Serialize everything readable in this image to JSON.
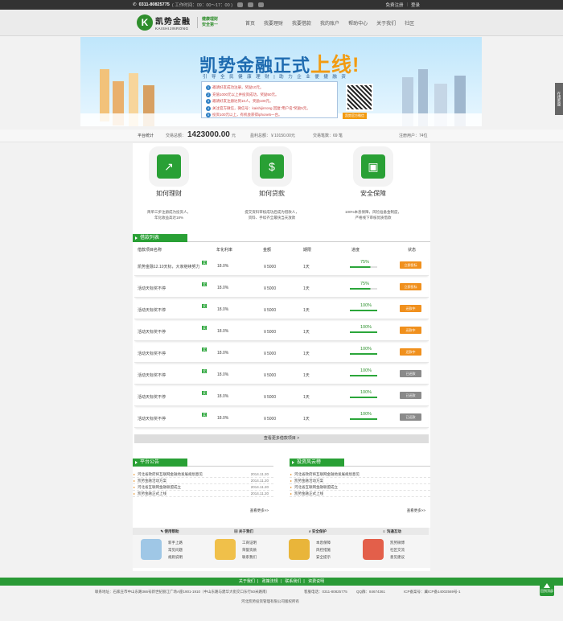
{
  "topbar": {
    "phone": "0311-80825775",
    "hours": "( 工作时间：09：00～17：00 )",
    "register": "免费注册",
    "login": "登录",
    "sep": "|"
  },
  "brand": {
    "mark": "K",
    "name": "凯势金融",
    "en": "KAISHIJINRONG",
    "slogan1": "健康理财",
    "slogan2": "安全第一"
  },
  "nav": [
    "首页",
    "我要理财",
    "我要借款",
    "我的账户",
    "帮助中心",
    "关于我们",
    "社区"
  ],
  "banner": {
    "title": "凯势金融正式",
    "title_highlight": "上线!",
    "subtitle": "引 导 全 民 健 康 理 财   |   助 力 企 业 便 捷 融 资",
    "steps": [
      "邀请好友成功注册，奖励10元。",
      "充值1000元以上并投资成功，奖励50元。",
      "邀请好友注册达到10人，奖励100元。",
      "关注官方微信，微信号：kaishijinrong 回复“用户名”奖励5元。",
      "投资100元以上，有机会获得iphone5一台。"
    ],
    "qr_caption": "凯势官方微信"
  },
  "side_tab": "在线客服",
  "stats": {
    "label": "平台统计",
    "volume_label": "交易总额：",
    "volume": "1423000.00",
    "volume_unit": "元",
    "income_label": "盈利总额：￥10150.00元",
    "count_label": "交易笔数：69 笔",
    "users_label": "注册用户：74位"
  },
  "features": [
    {
      "icon": "trend-up-icon",
      "glyph": "↗",
      "title": "如何理财",
      "desc1": "简单三步注册成为投资人，",
      "desc2": "年化收益高达18%"
    },
    {
      "icon": "money-bag-icon",
      "glyph": "$",
      "title": "如何贷款",
      "desc1": "提交资料审核成功后成为借款人，",
      "desc2": "资料、手续齐全最快当天放款"
    },
    {
      "icon": "lock-icon",
      "glyph": "▣",
      "title": "安全保障",
      "desc1": "100%本息保障，风险准备金制度，",
      "desc2": "严格线下审核优质借款"
    }
  ],
  "loans": {
    "section_title": "借款列表",
    "headers": [
      "借款项目名称",
      "年化利率",
      "金额",
      "期限",
      "进度",
      "状态"
    ],
    "rows": [
      {
        "name": "凯势金融12.10天标，大家继续努力",
        "rate": "18.0%",
        "amount": "￥5000",
        "term": "1天",
        "progress": "75%",
        "progress_value": 75,
        "status": "立即投标",
        "color": "#f0901d"
      },
      {
        "name": "活动天标奖不停",
        "rate": "18.0%",
        "amount": "￥5000",
        "term": "1天",
        "progress": "75%",
        "progress_value": 75,
        "status": "立即投标",
        "color": "#f0901d"
      },
      {
        "name": "活动天标奖不停",
        "rate": "18.0%",
        "amount": "￥5000",
        "term": "1天",
        "progress": "100%",
        "progress_value": 100,
        "status": "还款中",
        "color": "#f0901d"
      },
      {
        "name": "活动天标奖不停",
        "rate": "18.0%",
        "amount": "￥5000",
        "term": "1天",
        "progress": "100%",
        "progress_value": 100,
        "status": "还款中",
        "color": "#f0901d"
      },
      {
        "name": "活动天标奖不停",
        "rate": "18.0%",
        "amount": "￥5000",
        "term": "1天",
        "progress": "100%",
        "progress_value": 100,
        "status": "还款中",
        "color": "#f0901d"
      },
      {
        "name": "活动天标奖不停",
        "rate": "18.0%",
        "amount": "￥5000",
        "term": "1天",
        "progress": "100%",
        "progress_value": 100,
        "status": "已还款",
        "color": "#8a8a8a"
      },
      {
        "name": "活动天标奖不停",
        "rate": "18.0%",
        "amount": "￥5000",
        "term": "1天",
        "progress": "100%",
        "progress_value": 100,
        "status": "已还款",
        "color": "#8a8a8a"
      },
      {
        "name": "活动天标奖不停",
        "rate": "18.0%",
        "amount": "￥5000",
        "term": "1天",
        "progress": "100%",
        "progress_value": 100,
        "status": "已还款",
        "color": "#8a8a8a"
      }
    ],
    "more": "查看更多借款项目 >"
  },
  "announcements": {
    "title": "平台公告",
    "items": [
      {
        "text": "河北省政府将互联网金融地发展规划意见",
        "date": "2014.11.20"
      },
      {
        "text": "凯势金融活动方案",
        "date": "2014.11.20"
      },
      {
        "text": "河北省互联网金融联盟成立",
        "date": "2014.11.20"
      },
      {
        "text": "凯势金融正式上线",
        "date": "2014.11.20"
      }
    ],
    "more": "查看更多>>"
  },
  "news": {
    "title": "投资风云榜",
    "items": [
      {
        "text": "河北省政府将互联网金融地发展规划意见"
      },
      {
        "text": "凯势金融活动方案"
      },
      {
        "text": "河北省互联网金融联盟成立"
      },
      {
        "text": "凯势金融正式上线"
      }
    ],
    "more": "查看更多>>"
  },
  "categories": [
    {
      "title": "使用帮助",
      "icon": "pencil-icon",
      "color": "#9fc7e6",
      "links": [
        "新手上路",
        "常见问题",
        "规则说明"
      ]
    },
    {
      "title": "关于我们",
      "icon": "coins-icon",
      "color": "#f0c04a",
      "links": [
        "工商证明",
        "荣誉资质",
        "联系我们"
      ]
    },
    {
      "title": "安全保护",
      "icon": "key-lock-icon",
      "color": "#e9b53a",
      "links": [
        "本息保障",
        "风控措施",
        "安全提示"
      ]
    },
    {
      "title": "沟通互动",
      "icon": "people-icon",
      "color": "#e35f4a",
      "links": [
        "凯势微博",
        "社区交流",
        "意见建议"
      ]
    }
  ],
  "footer": {
    "links": [
      "关于我们",
      "政策法规",
      "联系我们",
      "资费说明"
    ],
    "address": "联系地址：石家庄市中山东路366号新世纪丽江广场A座1901-1910（中山东路与建华大街交口东行50米路南）",
    "phone": "客服电话：0311-80825775",
    "qq": "QQ群：84674361",
    "icp": "ICP备案号：冀ICP备14002569号-1",
    "company": "河北凯势投资管理有限公司版权所有",
    "gotop": "回到顶部"
  }
}
